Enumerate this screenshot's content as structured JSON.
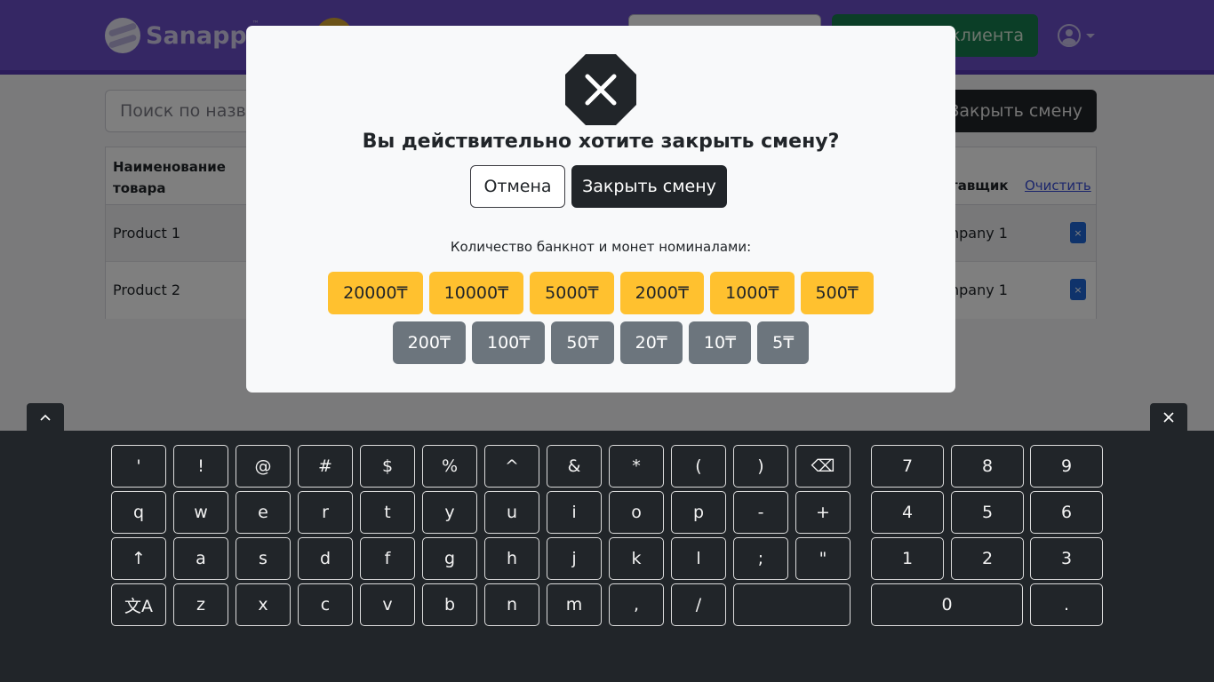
{
  "header": {
    "logo_text": "Sanapp",
    "logo_tm": "™",
    "new_client_label": "клиента"
  },
  "main": {
    "search_placeholder": "Поиск по назва",
    "close_shift_label": "Закрыть смену",
    "table": {
      "header_name": "Наименование товара",
      "header_supplier": "тавщик",
      "clear_label": "Очистить",
      "rows": [
        {
          "name": "Product 1",
          "company": "npany 1",
          "remove": "×"
        },
        {
          "name": "Product 2",
          "company": "npany 1",
          "remove": "×"
        }
      ]
    }
  },
  "modal": {
    "title": "Вы действительно хотите закрыть смену?",
    "cancel_label": "Отмена",
    "confirm_label": "Закрыть смену",
    "denominations_label": "Количество банкнот и монет номиналами:",
    "bills": [
      "20000₸",
      "10000₸",
      "5000₸",
      "2000₸",
      "1000₸",
      "500₸"
    ],
    "coins": [
      "200₸",
      "100₸",
      "50₸",
      "20₸",
      "10₸",
      "5₸"
    ]
  },
  "keyboard": {
    "rows": [
      [
        "'",
        "!",
        "@",
        "#",
        "$",
        "%",
        "^",
        "&",
        "*",
        "(",
        ")",
        "⌫"
      ],
      [
        "q",
        "w",
        "e",
        "r",
        "t",
        "y",
        "u",
        "i",
        "o",
        "p",
        "-",
        "+"
      ],
      [
        "↑",
        "a",
        "s",
        "d",
        "f",
        "g",
        "h",
        "j",
        "k",
        "l",
        ";",
        "\""
      ],
      [
        "文A",
        "z",
        "x",
        "c",
        "v",
        "b",
        "n",
        "m",
        ",",
        "/",
        " "
      ]
    ],
    "numpad": [
      [
        "7",
        "8",
        "9"
      ],
      [
        "4",
        "5",
        "6"
      ],
      [
        "1",
        "2",
        "3"
      ],
      [
        "0",
        "."
      ]
    ],
    "collapse_icon": "chevron-up-icon",
    "close_icon": "close-icon"
  }
}
